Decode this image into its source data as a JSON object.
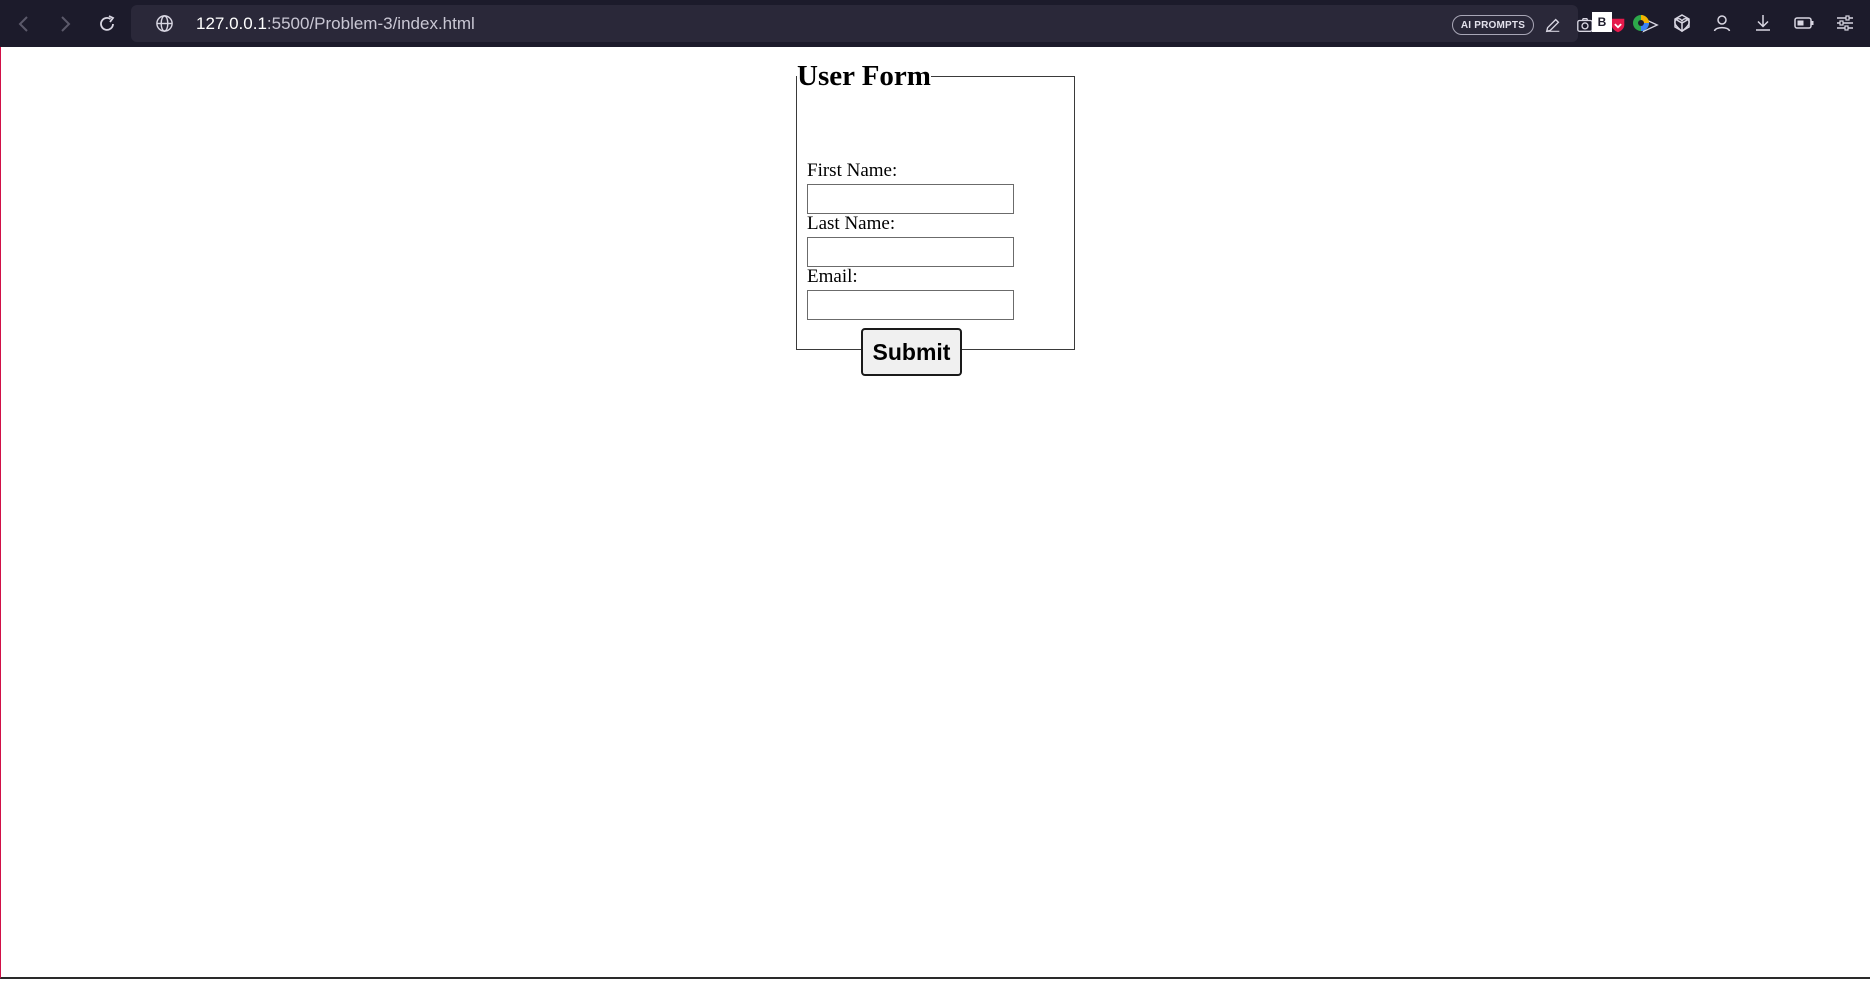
{
  "browser": {
    "url_host": "127.0.0.1",
    "url_path": ":5500/Problem-3/index.html",
    "ai_prompts_label": "AI PROMPTS",
    "extension_b_label": "B",
    "icons": [
      "back-icon",
      "forward-icon",
      "reload-icon",
      "globe-icon",
      "edit-icon",
      "camera-icon",
      "shield-icon",
      "send-icon",
      "heart-icon",
      "extension-b-icon",
      "colorful-extension-icon",
      "cube-icon",
      "profile-icon",
      "download-icon",
      "battery-icon",
      "settings-sliders-icon"
    ],
    "colors": {
      "toolbar": "#1c1b2b",
      "urlbar": "#2a2839",
      "shield": "#e5194b"
    }
  },
  "form": {
    "legend": "User Form",
    "first_name_label": "First Name:",
    "last_name_label": "Last Name:",
    "email_label": "Email:",
    "first_name_value": "",
    "last_name_value": "",
    "email_value": "",
    "submit_label": "Submit"
  }
}
